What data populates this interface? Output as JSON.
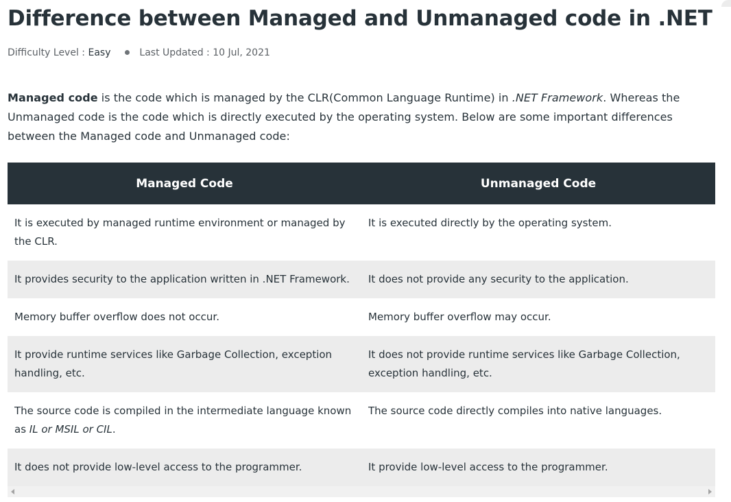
{
  "article": {
    "title": "Difference between Managed and Unmanaged code in .NET",
    "meta": {
      "difficulty_label": "Difficulty Level : ",
      "difficulty_value": "Easy",
      "updated_label": "Last Updated : ",
      "updated_value": "10 Jul, 2021"
    },
    "intro": {
      "bold_term": "Managed code",
      "part1": " is the code which is managed by the CLR(Common Language Runtime) in ",
      "italic_term": ".NET Framework",
      "part2": ". Whereas the Unmanaged code is the code which is directly executed by the operating system. Below are some important differences between the Managed code and Unmanaged code:"
    }
  },
  "table": {
    "headers": {
      "managed": "Managed Code",
      "unmanaged": "Unmanaged Code"
    },
    "rows": [
      {
        "managed": "It is executed by managed runtime environment or managed by the CLR.",
        "unmanaged": "It is executed directly by the operating system."
      },
      {
        "managed": "It provides security to the application written in .NET Framework.",
        "unmanaged": "It does not provide any security to the application."
      },
      {
        "managed": "Memory buffer overflow does not occur.",
        "unmanaged": "Memory buffer overflow may occur."
      },
      {
        "managed": "It provide runtime services like Garbage Collection, exception handling, etc.",
        "unmanaged": "It does not provide runtime services like Garbage Collection, exception handling, etc."
      },
      {
        "managed_prefix": "The source code is compiled in the intermediate language known as ",
        "managed_italic": "IL or MSIL or CIL",
        "managed_suffix": ".",
        "unmanaged": "The source code directly compiles into native languages."
      },
      {
        "managed": "It does not provide low-level access to the programmer.",
        "unmanaged": "It provide low-level access to the programmer."
      }
    ]
  },
  "icons": {
    "scroll_left": "chevron-left-icon",
    "scroll_right": "chevron-right-icon"
  },
  "colors": {
    "header_bg": "#273239",
    "alt_row_bg": "#ececec",
    "text": "#273239"
  }
}
